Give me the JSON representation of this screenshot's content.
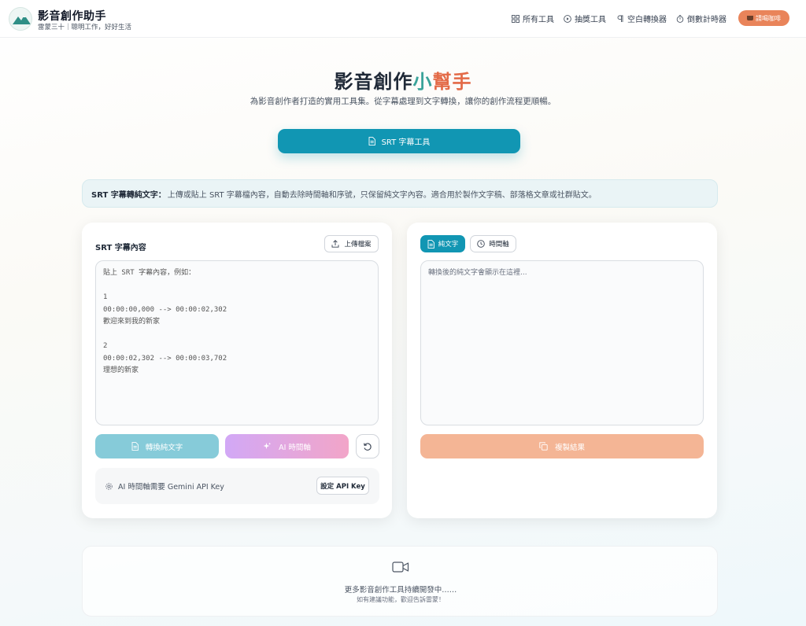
{
  "header": {
    "brand_title": "影音創作助手",
    "brand_subtitle": "雷蒙三十｜聰明工作，好好生活",
    "logo_text": "雷蒙三十",
    "nav": [
      {
        "label": "所有工具",
        "icon": "grid-icon"
      },
      {
        "label": "抽獎工具",
        "icon": "play-circle-icon"
      },
      {
        "label": "空白轉換器",
        "icon": "pilcrow-icon"
      },
      {
        "label": "倒數計時器",
        "icon": "timer-icon"
      }
    ],
    "coffee_label": "請喝咖啡"
  },
  "hero": {
    "title_part1": "影音創作",
    "title_part2": "小",
    "title_part3": "幫手",
    "subtitle": "為影音創作者打造的實用工具集。從字幕處理到文字轉換，讓你的創作流程更順暢。",
    "main_tab": "SRT 字幕工具"
  },
  "info": {
    "label": "SRT 字幕轉純文字：",
    "text": "上傳或貼上 SRT 字幕檔內容，自動去除時間軸和序號，只保留純文字內容。適合用於製作文字稿、部落格文章或社群貼文。"
  },
  "left_card": {
    "label": "SRT 字幕內容",
    "upload_label": "上傳檔案",
    "placeholder": "貼上 SRT 字幕內容，例如：\n\n1\n00:00:00,000 --> 00:00:02,302\n歡迎來到我的新家\n\n2\n00:00:02,302 --> 00:00:03,702\n理想的新家",
    "convert_label": "轉換純文字",
    "ai_label": "AI 時間軸",
    "api_note": "AI 時間軸需要 Gemini API Key",
    "api_button": "設定 API Key"
  },
  "right_card": {
    "seg_plain": "純文字",
    "seg_timeline": "時間軸",
    "placeholder": "轉換後的純文字會顯示在這裡...",
    "copy_label": "複製結果"
  },
  "footer": {
    "line1": "更多影音創作工具持續開發中……",
    "line2": "如有建議功能，歡迎告訴雷蒙！"
  },
  "colors": {
    "primary": "#1196b3",
    "accent": "#e9845a",
    "teal_text": "#3aa39a",
    "orange_text": "#e36a47"
  }
}
